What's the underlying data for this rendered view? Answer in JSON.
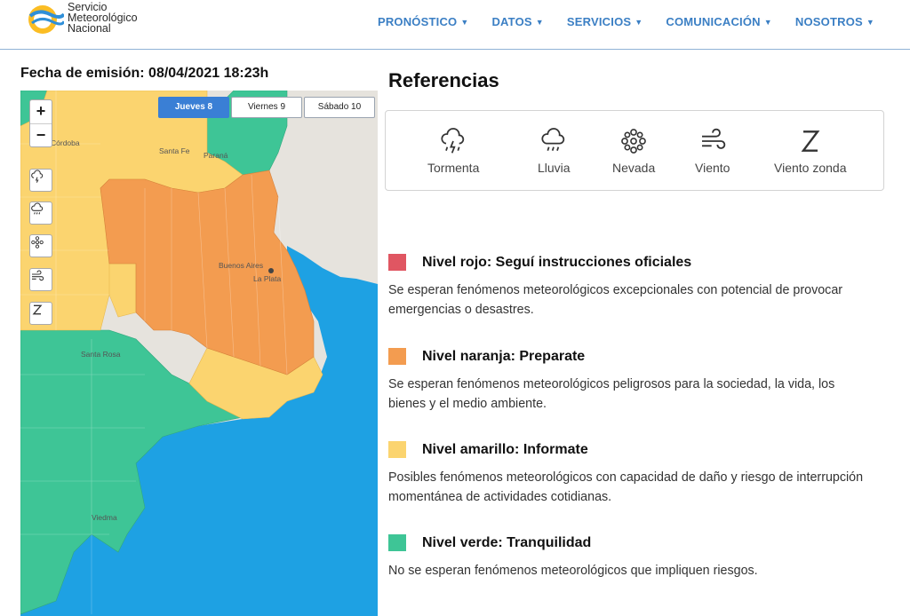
{
  "header": {
    "logo_lines": [
      "Servicio",
      "Meteorológico",
      "Nacional"
    ],
    "nav": [
      {
        "label": "PRONÓSTICO"
      },
      {
        "label": "DATOS"
      },
      {
        "label": "SERVICIOS"
      },
      {
        "label": "COMUNICACIÓN"
      },
      {
        "label": "NOSOTROS"
      }
    ]
  },
  "emision": {
    "label": "Fecha de emisión: 08/04/2021 18:23h"
  },
  "map": {
    "tabs": [
      {
        "label": "Jueves 8",
        "active": true
      },
      {
        "label": "Viernes 9",
        "active": false
      },
      {
        "label": "Sábado 10",
        "active": false
      }
    ],
    "zoom_in": "+",
    "zoom_out": "−",
    "places": {
      "cordoba": "Córdoba",
      "santa_fe": "Santa Fe",
      "parana": "Paraná",
      "buenos_aires": "Buenos Aires",
      "la_plata": "La Plata",
      "santa_rosa": "Santa Rosa",
      "viedma": "Viedma"
    },
    "colors": {
      "red": "#e05662",
      "orange": "#f39c50",
      "yellow": "#fbd46f",
      "green": "#3ec596",
      "sea": "#1ea1e3",
      "land": "#e6e3dd"
    }
  },
  "referencias": {
    "title": "Referencias",
    "items": [
      {
        "label": "Tormenta",
        "icon": "storm-icon"
      },
      {
        "label": "Lluvia",
        "icon": "rain-icon"
      },
      {
        "label": "Nevada",
        "icon": "snow-icon"
      },
      {
        "label": "Viento",
        "icon": "wind-icon"
      },
      {
        "label": "Viento zonda",
        "icon": "zonda-icon"
      }
    ]
  },
  "levels": [
    {
      "title": "Nivel rojo: Seguí instrucciones oficiales",
      "color": "#e05662",
      "desc": "Se esperan fenómenos meteorológicos excepcionales con potencial de provocar emergencias o desastres."
    },
    {
      "title": "Nivel naranja: Preparate",
      "color": "#f39c50",
      "desc": "Se esperan fenómenos meteorológicos peligrosos para la sociedad, la vida, los bienes y el medio ambiente."
    },
    {
      "title": "Nivel amarillo: Informate",
      "color": "#fbd46f",
      "desc": "Posibles fenómenos meteorológicos con capacidad de daño y riesgo de interrupción momentánea de actividades cotidianas."
    },
    {
      "title": "Nivel verde: Tranquilidad",
      "color": "#3ec596",
      "desc": "No se esperan fenómenos meteorológicos que impliquen riesgos."
    }
  ]
}
